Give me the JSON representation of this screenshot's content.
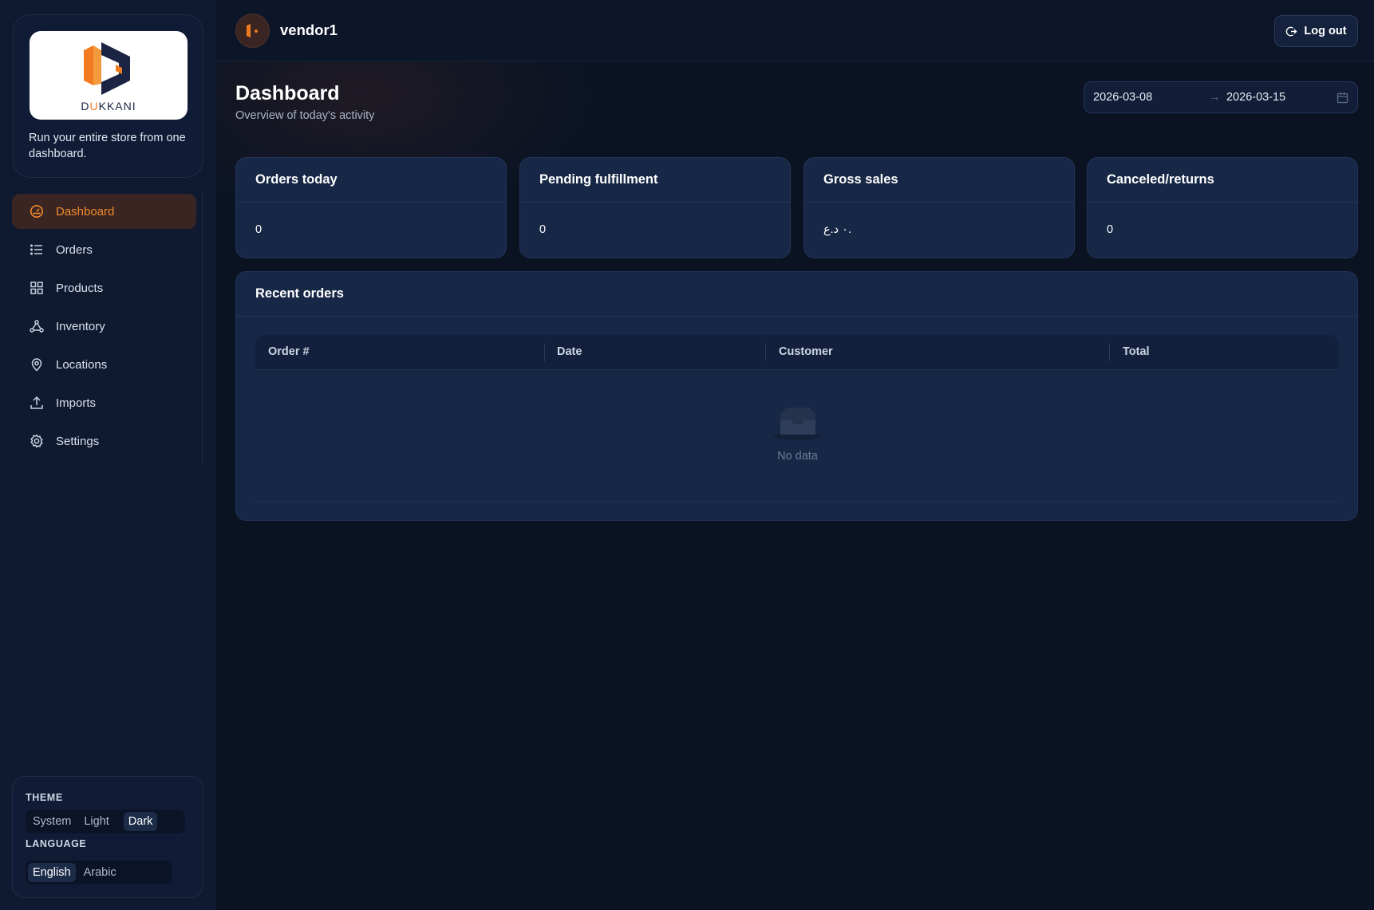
{
  "brand": {
    "logo_text_prefix": "D",
    "logo_text_highlight": "U",
    "logo_text_rest": "KKANI",
    "tagline": "Run your entire store from one dashboard."
  },
  "nav": {
    "items": [
      {
        "label": "Dashboard",
        "icon": "gauge-icon",
        "active": true
      },
      {
        "label": "Orders",
        "icon": "list-icon"
      },
      {
        "label": "Products",
        "icon": "grid-icon"
      },
      {
        "label": "Inventory",
        "icon": "network-icon"
      },
      {
        "label": "Locations",
        "icon": "map-pin-icon"
      },
      {
        "label": "Imports",
        "icon": "upload-icon"
      },
      {
        "label": "Settings",
        "icon": "gear-icon"
      }
    ]
  },
  "preferences": {
    "theme_label": "THEME",
    "theme_options": [
      "System",
      "Light",
      "Dark"
    ],
    "theme_selected": "Dark",
    "language_label": "LANGUAGE",
    "language_options": [
      "English",
      "Arabic"
    ],
    "language_selected": "English"
  },
  "header": {
    "username": "vendor1",
    "logout_label": "Log out"
  },
  "page": {
    "title": "Dashboard",
    "subtitle": "Overview of today's activity",
    "date_start": "2026-03-08",
    "date_end": "2026-03-15",
    "date_separator": "→"
  },
  "stats": [
    {
      "label": "Orders today",
      "value": "0"
    },
    {
      "label": "Pending fulfillment",
      "value": "0"
    },
    {
      "label": "Gross sales",
      "value": "٠ د.ع."
    },
    {
      "label": "Canceled/returns",
      "value": "0"
    }
  ],
  "recent_orders": {
    "title": "Recent orders",
    "columns": [
      "Order #",
      "Date",
      "Customer",
      "Total"
    ],
    "rows": [],
    "empty_text": "No data"
  },
  "colors": {
    "accent": "#f08a2a",
    "background": "#0b1323",
    "card": "#172746"
  }
}
